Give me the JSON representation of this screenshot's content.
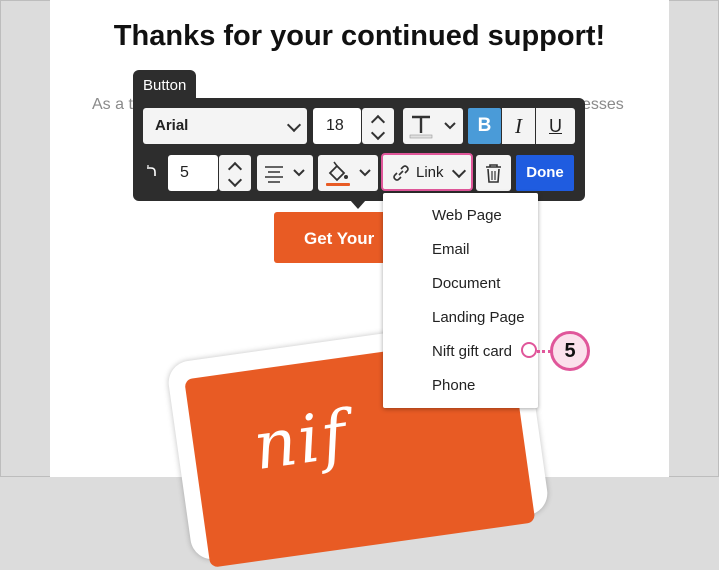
{
  "email": {
    "heading": "Thanks for your continued support!",
    "body_left": "As a t",
    "body_right": "esses",
    "cta_label": "Get Your",
    "card_text": "nif"
  },
  "toolbar": {
    "tag_label": "Button",
    "font_family": "Arial",
    "font_size": "18",
    "bold_label": "B",
    "italic_label": "I",
    "underline_label": "U",
    "corner_radius": "5",
    "link_label": "Link",
    "done_label": "Done"
  },
  "link_menu": {
    "items": [
      "Web Page",
      "Email",
      "Document",
      "Landing Page",
      "Nift gift card",
      "Phone"
    ]
  },
  "callout": {
    "number": "5"
  },
  "colors": {
    "accent_orange": "#e85b24",
    "toolbar_bg": "#2d2d2d",
    "bold_active": "#4a9bd8",
    "done_blue": "#1f5ce0",
    "highlight_pink": "#e0569a"
  }
}
